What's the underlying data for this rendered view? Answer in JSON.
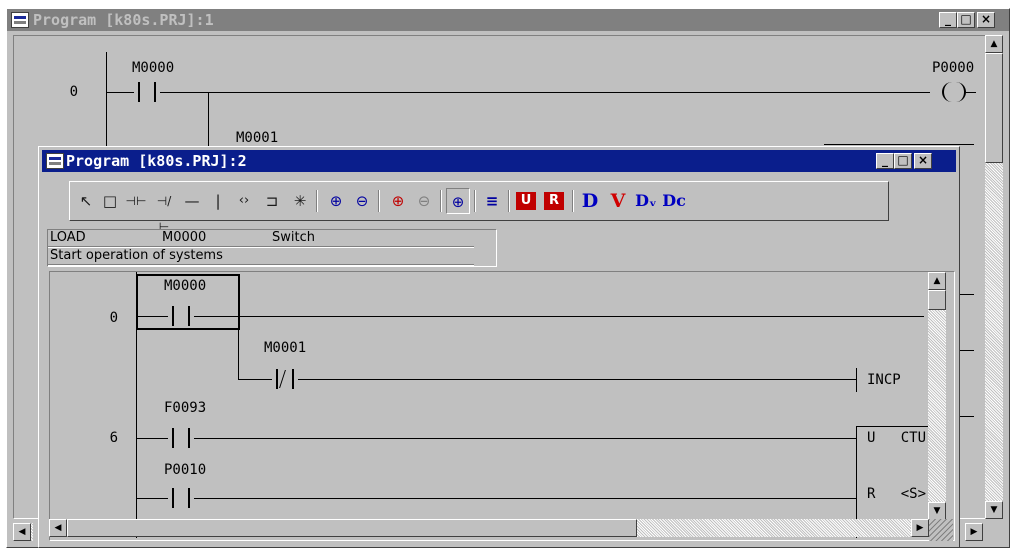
{
  "back_window": {
    "title": "Program  [k80s.PRJ]:1",
    "caption_buttons": [
      "_",
      "□",
      "×"
    ],
    "ladder": {
      "row0_number": "0",
      "contact1": "M0000",
      "contact2": "M0001",
      "coil": "P0000"
    }
  },
  "front_window": {
    "title": "Program  [k80s.PRJ]:2",
    "caption_buttons": [
      "_",
      "□",
      "×"
    ],
    "toolbar": [
      {
        "name": "select-arrow-icon",
        "glyph": "↖"
      },
      {
        "name": "rectangle-icon",
        "glyph": "□"
      },
      {
        "name": "no-contact-icon",
        "glyph": "⊣⊢"
      },
      {
        "name": "nc-contact-icon",
        "glyph": "⊣/⊢"
      },
      {
        "name": "horizontal-line-icon",
        "glyph": "—"
      },
      {
        "name": "vertical-line-icon",
        "glyph": "|"
      },
      {
        "name": "coil-icon",
        "glyph": "‹›"
      },
      {
        "name": "function-block-icon",
        "glyph": "⊐"
      },
      {
        "name": "asterisk-icon",
        "glyph": "✳"
      },
      {
        "name": "zoom-in-icon",
        "glyph": "⊕"
      },
      {
        "name": "zoom-out-icon",
        "glyph": "⊖"
      },
      {
        "name": "zoom-in-red-icon",
        "glyph": "⊕"
      },
      {
        "name": "zoom-out-gray-icon",
        "glyph": "⊖"
      },
      {
        "name": "zoom-fit-icon",
        "glyph": "⊕"
      },
      {
        "name": "align-icon",
        "glyph": "≡"
      },
      {
        "name": "monitor-u-icon",
        "glyph": "U"
      },
      {
        "name": "monitor-r-icon",
        "glyph": "R"
      }
    ],
    "toolbar_letters": [
      {
        "name": "d-icon",
        "glyph": "D",
        "color": "#0000c0"
      },
      {
        "name": "v-icon",
        "glyph": "V",
        "color": "#d00000"
      },
      {
        "name": "dv-icon",
        "glyph": "Dᵥ",
        "color": "#0000c0"
      },
      {
        "name": "dc-icon",
        "glyph": "Dc",
        "color": "#0000c0"
      }
    ],
    "info": {
      "instruction": "LOAD",
      "operand": "M0000",
      "comment": "Switch",
      "description": "Start operation of systems"
    },
    "ladder": {
      "row_numbers": [
        "0",
        "6"
      ],
      "contacts": [
        "M0000",
        "M0001",
        "F0093",
        "P0010"
      ],
      "outputs": [
        "INCP",
        "U   CTU",
        "R   <S>"
      ]
    }
  },
  "colors": {
    "active_title": "#0a1e8c",
    "inactive_title": "#808080",
    "face": "#c0c0c0"
  }
}
